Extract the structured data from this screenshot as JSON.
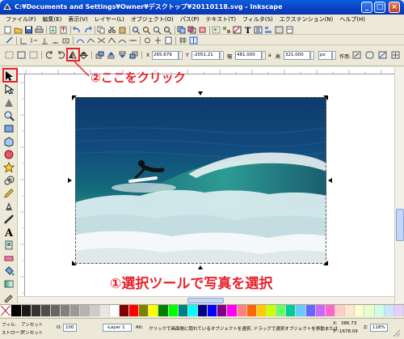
{
  "window": {
    "title": "C:¥Documents and Settings¥Owner¥デスクトップ¥20110118.svg - Inkscape",
    "minimize": "_",
    "maximize": "□",
    "close": "×"
  },
  "menu": [
    "ファイル(F)",
    "編集(E)",
    "表示(V)",
    "レイヤー(L)",
    "オブジェクト(O)",
    "パス(P)",
    "テキスト(T)",
    "フィルタ(S)",
    "エクステンション(N)",
    "ヘルプ(H)"
  ],
  "controls": {
    "x_label": "X",
    "x_value": "265.679",
    "y_label": "Y",
    "y_value": "-2051.21",
    "w_label": "幅",
    "w_value": "481.000",
    "lock_icon": "a",
    "h_label": "高",
    "h_value": "321.000",
    "unit": "px",
    "behavior_label": "作用:"
  },
  "status": {
    "fill_label": "フィル:",
    "fill_value": "アンセット",
    "stroke_label": "ストローク:",
    "stroke_value": "アンセット",
    "opacity_label": "O:",
    "opacity_value": "100",
    "layer_value": "-Layer 1",
    "message_prefix": "Alt:",
    "message": "クリックで画面側に隠れているオブジェクトを選択, ドラッグで選択オブジェクトを移動または",
    "coord_x_label": "X:",
    "coord_x_value": "386.73",
    "coord_y_label": "Y:",
    "coord_y_value": "-1678.09",
    "zoom_label": "Z:",
    "zoom_value": "118%"
  },
  "annotations": {
    "step1": "①選択ツールで写真を選択",
    "step2": "②ここをクリック",
    "accent_color": "#e8222c"
  },
  "palette": [
    "#000000",
    "#1a1a1a",
    "#333333",
    "#4d4d4d",
    "#666666",
    "#808080",
    "#999999",
    "#b3b3b3",
    "#cccccc",
    "#e6e6e6",
    "#ffffff",
    "#800000",
    "#ff0000",
    "#808000",
    "#ffff00",
    "#008000",
    "#00ff00",
    "#008080",
    "#00ffff",
    "#000080",
    "#0000ff",
    "#800080",
    "#ff00ff",
    "#ff8080",
    "#ff6600",
    "#ffcc00",
    "#ccff00",
    "#66ff66",
    "#00cc99",
    "#66ccff",
    "#6666ff",
    "#cc66ff",
    "#ff66cc",
    "#ffcccc",
    "#ffe6cc",
    "#ffffcc",
    "#e6ffcc",
    "#ccffe6",
    "#cce6ff",
    "#e6ccff"
  ]
}
